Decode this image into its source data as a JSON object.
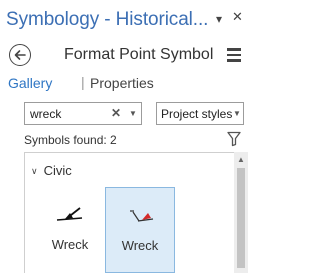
{
  "window": {
    "title": "Symbology - Historical...",
    "pin_icon": "pin-dropdown-icon",
    "close_icon": "close-icon"
  },
  "header": {
    "title": "Format Point Symbol",
    "back_icon": "back-arrow-icon",
    "menu_icon": "menu-icon"
  },
  "tabs": [
    {
      "label": "Gallery",
      "active": true
    },
    {
      "label": "Properties",
      "active": false
    }
  ],
  "tab_separator": "|",
  "search": {
    "value": "wreck",
    "clear_glyph": "✕",
    "dropdown_glyph": "▼"
  },
  "style_select": {
    "selected": "Project styles",
    "dropdown_glyph": "▼"
  },
  "results": {
    "count_text": "Symbols found: 2",
    "filter_icon": "filter-icon"
  },
  "group": {
    "label": "Civic",
    "chevron_glyph": "∨",
    "expanded": true
  },
  "symbols": [
    {
      "label": "Wreck",
      "selected": false,
      "icon": "wreck-black-icon"
    },
    {
      "label": "Wreck",
      "selected": true,
      "icon": "wreck-red-icon",
      "accent_color": "#d42a2a"
    }
  ],
  "colors": {
    "title": "#3c6fb4",
    "active_tab": "#2f76c4",
    "selection_fill": "#dcebf8",
    "selection_border": "#8ab8e0"
  }
}
